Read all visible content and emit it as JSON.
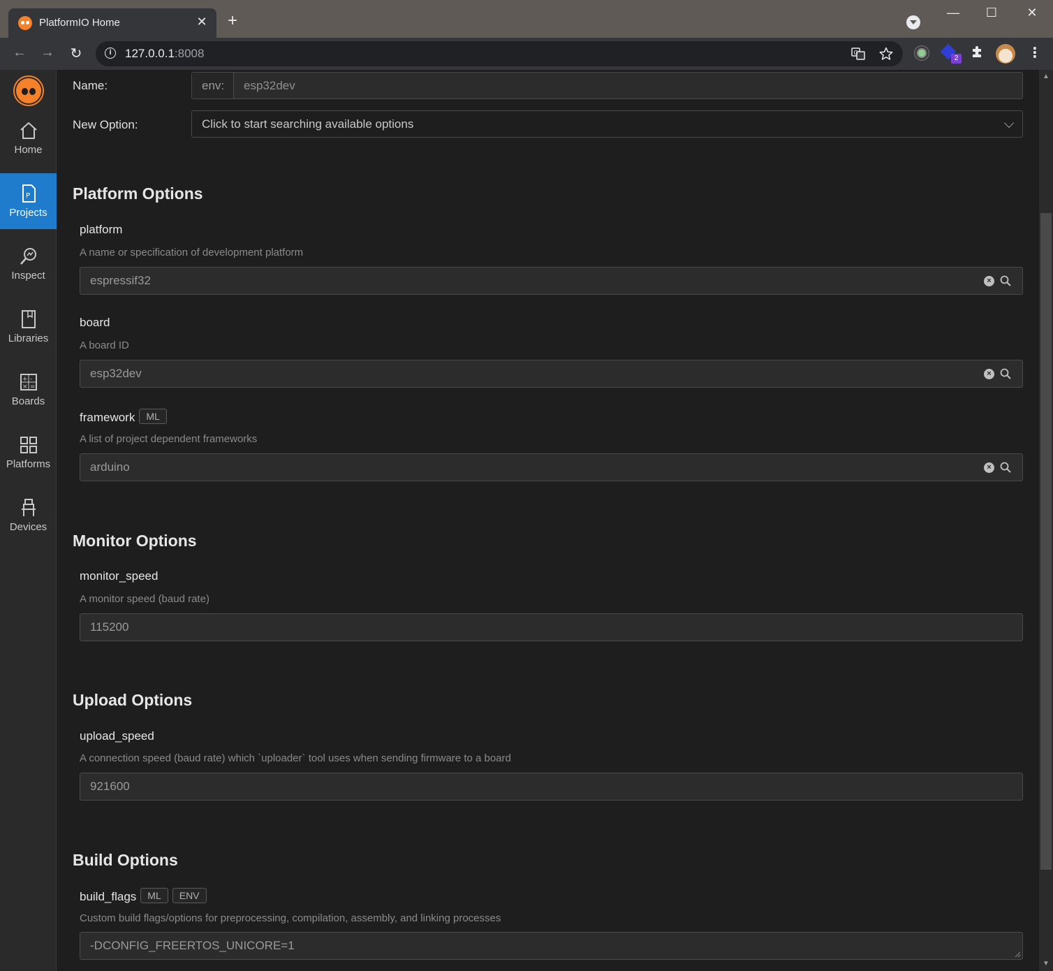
{
  "browser": {
    "tab_title": "PlatformIO Home",
    "tab_close": "✕",
    "new_tab": "+",
    "url_host": "127.0.0.1",
    "url_port": ":8008",
    "ext_badge": "2"
  },
  "sidebar": {
    "items": [
      {
        "label": "Home",
        "icon": "home-icon"
      },
      {
        "label": "Projects",
        "icon": "projects-icon",
        "active": true
      },
      {
        "label": "Inspect",
        "icon": "inspect-icon"
      },
      {
        "label": "Libraries",
        "icon": "libraries-icon"
      },
      {
        "label": "Boards",
        "icon": "boards-icon"
      },
      {
        "label": "Platforms",
        "icon": "platforms-icon"
      },
      {
        "label": "Devices",
        "icon": "devices-icon"
      }
    ]
  },
  "form": {
    "name_label": "Name:",
    "name_prefix": "env:",
    "name_value": "esp32dev",
    "new_option_label": "New Option:",
    "new_option_placeholder": "Click to start searching available options"
  },
  "sections": {
    "platform": {
      "title": "Platform Options",
      "options": [
        {
          "name": "platform",
          "desc": "A name or specification of development platform",
          "value": "espressif32"
        },
        {
          "name": "board",
          "desc": "A board ID",
          "value": "esp32dev"
        },
        {
          "name": "framework",
          "tags": [
            "ML"
          ],
          "desc": "A list of project dependent frameworks",
          "value": "arduino"
        }
      ]
    },
    "monitor": {
      "title": "Monitor Options",
      "options": [
        {
          "name": "monitor_speed",
          "desc": "A monitor speed (baud rate)",
          "value": "115200"
        }
      ]
    },
    "upload": {
      "title": "Upload Options",
      "options": [
        {
          "name": "upload_speed",
          "desc": "A connection speed (baud rate) which `uploader` tool uses when sending firmware to a board",
          "value": "921600"
        }
      ]
    },
    "build": {
      "title": "Build Options",
      "options": [
        {
          "name": "build_flags",
          "tags": [
            "ML",
            "ENV"
          ],
          "desc": "Custom build flags/options for preprocessing, compilation, assembly, and linking processes",
          "value": "-DCONFIG_FREERTOS_UNICORE=1"
        }
      ]
    }
  },
  "colors": {
    "accent": "#1f7ccc",
    "brand": "#f5822a",
    "background": "#1e1e1e"
  }
}
